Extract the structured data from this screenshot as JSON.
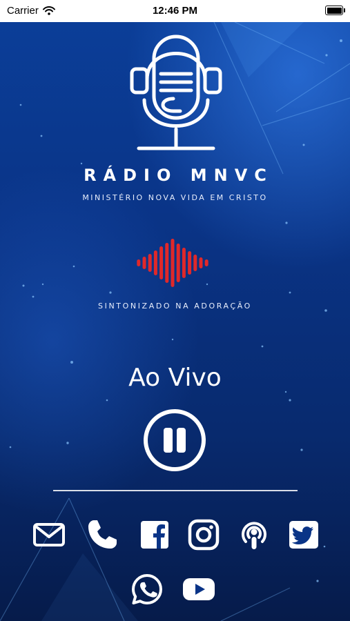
{
  "status_bar": {
    "carrier": "Carrier",
    "time": "12:46 PM",
    "battery_level": 1.0
  },
  "brand": {
    "logo_icon": "microphone-headphones-icon",
    "title": "RÁDIO MNVC",
    "subtitle": "MINISTÉRIO NOVA VIDA EM CRISTO"
  },
  "tagline_icon": "sound-wave-icon",
  "tagline": "SINTONIZADO NA ADORAÇÃO",
  "player": {
    "status_label": "Ao Vivo",
    "control_icon": "pause-icon"
  },
  "social_links": [
    {
      "name": "email",
      "icon": "mail-icon"
    },
    {
      "name": "phone",
      "icon": "phone-icon"
    },
    {
      "name": "facebook",
      "icon": "facebook-icon"
    },
    {
      "name": "instagram",
      "icon": "instagram-icon"
    },
    {
      "name": "podcast",
      "icon": "podcast-icon"
    },
    {
      "name": "twitter",
      "icon": "twitter-icon"
    },
    {
      "name": "whatsapp",
      "icon": "whatsapp-icon"
    },
    {
      "name": "youtube",
      "icon": "youtube-icon"
    }
  ],
  "colors": {
    "background_top": "#0b3f9a",
    "background_bottom": "#061b4a",
    "accent_red": "#e0282a",
    "foreground": "#ffffff"
  }
}
